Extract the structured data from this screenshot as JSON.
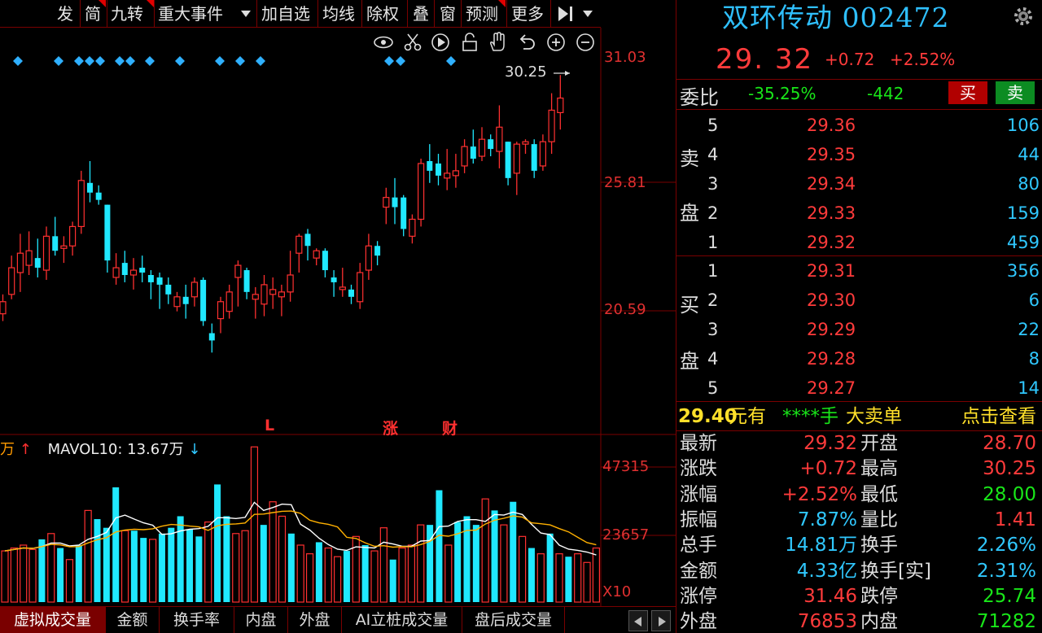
{
  "toolbar": {
    "items": [
      "发",
      "简",
      "九转",
      "重大事件",
      "加自选",
      "均线",
      "除权",
      "叠",
      "窗",
      "预测",
      "更多"
    ]
  },
  "chart": {
    "high_label": "30.25",
    "price_ticks": [
      "31.03",
      "25.81",
      "20.59"
    ],
    "volume_ticks": [
      "47315",
      "23657",
      "X10"
    ],
    "markers": [
      "L",
      "涨",
      "财"
    ],
    "vol_header_unit": "万",
    "vol_header_up": "↑",
    "mavol_label": "MAVOL10: 13.67万",
    "mavol_arrow": "↓"
  },
  "chart_data": {
    "type": "candlestick",
    "price_axis_ticks": [
      31.03,
      25.81,
      20.59
    ],
    "highest_marked": 30.25,
    "volume_axis_ticks": [
      47315,
      23657
    ],
    "volume_axis_unit_label": "X10",
    "candles": [
      {
        "o": 20.4,
        "c": 20.9,
        "h": 21.2,
        "l": 20.1
      },
      {
        "o": 21.2,
        "c": 22.3,
        "h": 22.8,
        "l": 21.0
      },
      {
        "o": 22.1,
        "c": 22.9,
        "h": 23.7,
        "l": 21.3
      },
      {
        "o": 22.4,
        "c": 23.0,
        "h": 23.8,
        "l": 22.0
      },
      {
        "o": 22.7,
        "c": 22.3,
        "h": 23.5,
        "l": 21.9
      },
      {
        "o": 22.2,
        "c": 23.6,
        "h": 24.0,
        "l": 21.8
      },
      {
        "o": 23.6,
        "c": 23.0,
        "h": 24.4,
        "l": 22.8
      },
      {
        "o": 23.1,
        "c": 23.2,
        "h": 23.6,
        "l": 22.5
      },
      {
        "o": 23.2,
        "c": 24.0,
        "h": 24.2,
        "l": 22.8
      },
      {
        "o": 24.0,
        "c": 25.9,
        "h": 26.3,
        "l": 23.7
      },
      {
        "o": 25.8,
        "c": 25.4,
        "h": 26.7,
        "l": 25.0
      },
      {
        "o": 25.4,
        "c": 25.1,
        "h": 25.7,
        "l": 24.9
      },
      {
        "o": 24.9,
        "c": 22.6,
        "h": 24.9,
        "l": 22.1
      },
      {
        "o": 21.9,
        "c": 22.3,
        "h": 22.9,
        "l": 21.6
      },
      {
        "o": 22.5,
        "c": 22.0,
        "h": 23.0,
        "l": 21.7
      },
      {
        "o": 22.0,
        "c": 22.2,
        "h": 22.7,
        "l": 21.4
      },
      {
        "o": 22.3,
        "c": 22.1,
        "h": 22.8,
        "l": 21.7
      },
      {
        "o": 22.0,
        "c": 21.7,
        "h": 22.2,
        "l": 21.0
      },
      {
        "o": 21.9,
        "c": 21.6,
        "h": 22.1,
        "l": 20.6
      },
      {
        "o": 21.6,
        "c": 21.2,
        "h": 21.9,
        "l": 20.8
      },
      {
        "o": 20.7,
        "c": 21.1,
        "h": 21.3,
        "l": 20.5
      },
      {
        "o": 21.1,
        "c": 20.8,
        "h": 21.6,
        "l": 20.2
      },
      {
        "o": 21.1,
        "c": 21.7,
        "h": 21.9,
        "l": 20.7
      },
      {
        "o": 21.8,
        "c": 20.1,
        "h": 21.9,
        "l": 19.9
      },
      {
        "o": 19.6,
        "c": 19.3,
        "h": 20.0,
        "l": 18.8
      },
      {
        "o": 20.2,
        "c": 20.9,
        "h": 21.1,
        "l": 19.6
      },
      {
        "o": 20.5,
        "c": 21.3,
        "h": 21.6,
        "l": 20.2
      },
      {
        "o": 21.9,
        "c": 22.4,
        "h": 22.6,
        "l": 20.7
      },
      {
        "o": 22.2,
        "c": 21.3,
        "h": 22.3,
        "l": 21.0
      },
      {
        "o": 21.0,
        "c": 21.2,
        "h": 21.5,
        "l": 20.2
      },
      {
        "o": 20.8,
        "c": 21.6,
        "h": 22.0,
        "l": 20.3
      },
      {
        "o": 21.2,
        "c": 21.4,
        "h": 21.9,
        "l": 20.6
      },
      {
        "o": 21.1,
        "c": 21.3,
        "h": 21.6,
        "l": 20.3
      },
      {
        "o": 21.3,
        "c": 22.0,
        "h": 23.0,
        "l": 20.9
      },
      {
        "o": 22.9,
        "c": 23.6,
        "h": 23.7,
        "l": 22.1
      },
      {
        "o": 23.7,
        "c": 23.2,
        "h": 23.9,
        "l": 22.6
      },
      {
        "o": 22.7,
        "c": 23.0,
        "h": 23.1,
        "l": 22.4
      },
      {
        "o": 23.0,
        "c": 22.2,
        "h": 23.1,
        "l": 21.9
      },
      {
        "o": 21.9,
        "c": 21.7,
        "h": 22.2,
        "l": 21.1
      },
      {
        "o": 21.4,
        "c": 21.5,
        "h": 22.3,
        "l": 21.1
      },
      {
        "o": 21.4,
        "c": 21.1,
        "h": 21.6,
        "l": 20.8
      },
      {
        "o": 20.9,
        "c": 22.1,
        "h": 22.5,
        "l": 20.6
      },
      {
        "o": 22.2,
        "c": 23.2,
        "h": 23.7,
        "l": 21.8
      },
      {
        "o": 23.2,
        "c": 22.8,
        "h": 23.4,
        "l": 22.4
      },
      {
        "o": 24.8,
        "c": 25.2,
        "h": 25.6,
        "l": 24.1
      },
      {
        "o": 25.2,
        "c": 24.8,
        "h": 26.0,
        "l": 24.1
      },
      {
        "o": 25.2,
        "c": 23.9,
        "h": 25.3,
        "l": 23.6
      },
      {
        "o": 23.6,
        "c": 24.3,
        "h": 24.5,
        "l": 23.3
      },
      {
        "o": 24.3,
        "c": 26.6,
        "h": 26.8,
        "l": 24.0
      },
      {
        "o": 26.7,
        "c": 26.3,
        "h": 27.4,
        "l": 25.8
      },
      {
        "o": 26.6,
        "c": 26.1,
        "h": 27.0,
        "l": 25.7
      },
      {
        "o": 26.0,
        "c": 26.2,
        "h": 27.2,
        "l": 25.5
      },
      {
        "o": 26.1,
        "c": 26.3,
        "h": 27.0,
        "l": 25.6
      },
      {
        "o": 26.5,
        "c": 27.3,
        "h": 27.6,
        "l": 26.2
      },
      {
        "o": 27.3,
        "c": 26.8,
        "h": 28.0,
        "l": 26.6
      },
      {
        "o": 26.9,
        "c": 27.6,
        "h": 28.1,
        "l": 26.7
      },
      {
        "o": 27.6,
        "c": 27.2,
        "h": 27.8,
        "l": 26.9
      },
      {
        "o": 27.1,
        "c": 28.1,
        "h": 29.0,
        "l": 26.4
      },
      {
        "o": 27.5,
        "c": 26.0,
        "h": 27.5,
        "l": 25.7
      },
      {
        "o": 26.2,
        "c": 27.4,
        "h": 27.5,
        "l": 25.3
      },
      {
        "o": 27.4,
        "c": 27.5,
        "h": 27.6,
        "l": 27.0
      },
      {
        "o": 27.4,
        "c": 26.3,
        "h": 27.6,
        "l": 26.0
      },
      {
        "o": 26.5,
        "c": 27.5,
        "h": 27.8,
        "l": 26.3
      },
      {
        "o": 27.5,
        "c": 28.8,
        "h": 29.5,
        "l": 27.0
      },
      {
        "o": 28.7,
        "c": 29.3,
        "h": 30.25,
        "l": 28.0
      }
    ],
    "volume": [
      {
        "v": 180,
        "up": true
      },
      {
        "v": 190,
        "up": true
      },
      {
        "v": 200,
        "up": true
      },
      {
        "v": 185,
        "up": true
      },
      {
        "v": 220,
        "up": false
      },
      {
        "v": 240,
        "up": true
      },
      {
        "v": 190,
        "up": false
      },
      {
        "v": 150,
        "up": true
      },
      {
        "v": 200,
        "up": false
      },
      {
        "v": 320,
        "up": true
      },
      {
        "v": 290,
        "up": false
      },
      {
        "v": 260,
        "up": false
      },
      {
        "v": 400,
        "up": false
      },
      {
        "v": 250,
        "up": true
      },
      {
        "v": 250,
        "up": false
      },
      {
        "v": 225,
        "up": false
      },
      {
        "v": 220,
        "up": true
      },
      {
        "v": 240,
        "up": false
      },
      {
        "v": 260,
        "up": false
      },
      {
        "v": 300,
        "up": false
      },
      {
        "v": 255,
        "up": false
      },
      {
        "v": 230,
        "up": false
      },
      {
        "v": 280,
        "up": true
      },
      {
        "v": 410,
        "up": false
      },
      {
        "v": 300,
        "up": false
      },
      {
        "v": 240,
        "up": true
      },
      {
        "v": 250,
        "up": true
      },
      {
        "v": 540,
        "up": true
      },
      {
        "v": 270,
        "up": false
      },
      {
        "v": 350,
        "up": true
      },
      {
        "v": 300,
        "up": true
      },
      {
        "v": 240,
        "up": false
      },
      {
        "v": 200,
        "up": true
      },
      {
        "v": 170,
        "up": true
      },
      {
        "v": 210,
        "up": false
      },
      {
        "v": 190,
        "up": true
      },
      {
        "v": 160,
        "up": true
      },
      {
        "v": 180,
        "up": false
      },
      {
        "v": 230,
        "up": true
      },
      {
        "v": 200,
        "up": false
      },
      {
        "v": 180,
        "up": true
      },
      {
        "v": 260,
        "up": true
      },
      {
        "v": 150,
        "up": false
      },
      {
        "v": 190,
        "up": true
      },
      {
        "v": 200,
        "up": true
      },
      {
        "v": 270,
        "up": true
      },
      {
        "v": 270,
        "up": false
      },
      {
        "v": 390,
        "up": false
      },
      {
        "v": 200,
        "up": true
      },
      {
        "v": 280,
        "up": false
      },
      {
        "v": 300,
        "up": false
      },
      {
        "v": 270,
        "up": false
      },
      {
        "v": 360,
        "up": true
      },
      {
        "v": 320,
        "up": false
      },
      {
        "v": 270,
        "up": true
      },
      {
        "v": 350,
        "up": false
      },
      {
        "v": 230,
        "up": true
      },
      {
        "v": 190,
        "up": false
      },
      {
        "v": 170,
        "up": true
      },
      {
        "v": 240,
        "up": false
      },
      {
        "v": 170,
        "up": true
      },
      {
        "v": 160,
        "up": false
      },
      {
        "v": 170,
        "up": true
      },
      {
        "v": 140,
        "up": true
      },
      {
        "v": 190,
        "up": true
      }
    ]
  },
  "tabs": [
    "虚拟成交量",
    "金额",
    "换手率",
    "内盘",
    "外盘",
    "AI立桩成交量",
    "盘后成交量"
  ],
  "panel": {
    "title": "双环传动 002472",
    "price": "29. 32",
    "change": "+0.72",
    "change_pct": "+2.52%",
    "weibi_label": "委比",
    "weibi_pct": "-35.25%",
    "weibi_diff": "-442",
    "buy_btn": "买",
    "sell_btn": "卖",
    "sell_side_chars": [
      "卖",
      "盘"
    ],
    "buy_side_chars": [
      "买",
      "盘"
    ],
    "asks": [
      {
        "level": "5",
        "price": "29.36",
        "qty": "106"
      },
      {
        "level": "4",
        "price": "29.35",
        "qty": "44"
      },
      {
        "level": "3",
        "price": "29.34",
        "qty": "80"
      },
      {
        "level": "2",
        "price": "29.33",
        "qty": "159"
      },
      {
        "level": "1",
        "price": "29.32",
        "qty": "459"
      }
    ],
    "bids": [
      {
        "level": "1",
        "price": "29.31",
        "qty": "356"
      },
      {
        "level": "2",
        "price": "29.30",
        "qty": "6"
      },
      {
        "level": "3",
        "price": "29.29",
        "qty": "22"
      },
      {
        "level": "4",
        "price": "29.28",
        "qty": "8"
      },
      {
        "level": "5",
        "price": "29.27",
        "qty": "14"
      }
    ],
    "big_order": {
      "price": "29.40",
      "unit": "元有",
      "hands": "****手",
      "desc": "大卖单",
      "link": "点击查看"
    },
    "stats": [
      {
        "l1": "最新",
        "v1": "29.32",
        "c1": "red",
        "l2": "开盘",
        "v2": "28.70",
        "c2": "red"
      },
      {
        "l1": "涨跌",
        "v1": "+0.72",
        "c1": "red",
        "l2": "最高",
        "v2": "30.25",
        "c2": "red"
      },
      {
        "l1": "涨幅",
        "v1": "+2.52%",
        "c1": "red",
        "l2": "最低",
        "v2": "28.00",
        "c2": "green"
      },
      {
        "l1": "振幅",
        "v1": "7.87%",
        "c1": "cyan",
        "l2": "量比",
        "v2": "1.41",
        "c2": "red"
      },
      {
        "l1": "总手",
        "v1": "14.81万",
        "c1": "cyan",
        "l2": "换手",
        "v2": "2.26%",
        "c2": "cyan"
      },
      {
        "l1": "金额",
        "v1": "4.33亿",
        "c1": "cyan",
        "l2": "换手[实]",
        "v2": "2.31%",
        "c2": "cyan"
      },
      {
        "l1": "涨停",
        "v1": "31.46",
        "c1": "red",
        "l2": "跌停",
        "v2": "25.74",
        "c2": "green"
      },
      {
        "l1": "外盘",
        "v1": "76853",
        "c1": "red",
        "l2": "内盘",
        "v2": "71282",
        "c2": "green"
      }
    ]
  },
  "colors": {
    "up": "#ff3030",
    "down": "#20e8ff",
    "grid": "#7a0000",
    "accent": "#2fc0ff"
  }
}
